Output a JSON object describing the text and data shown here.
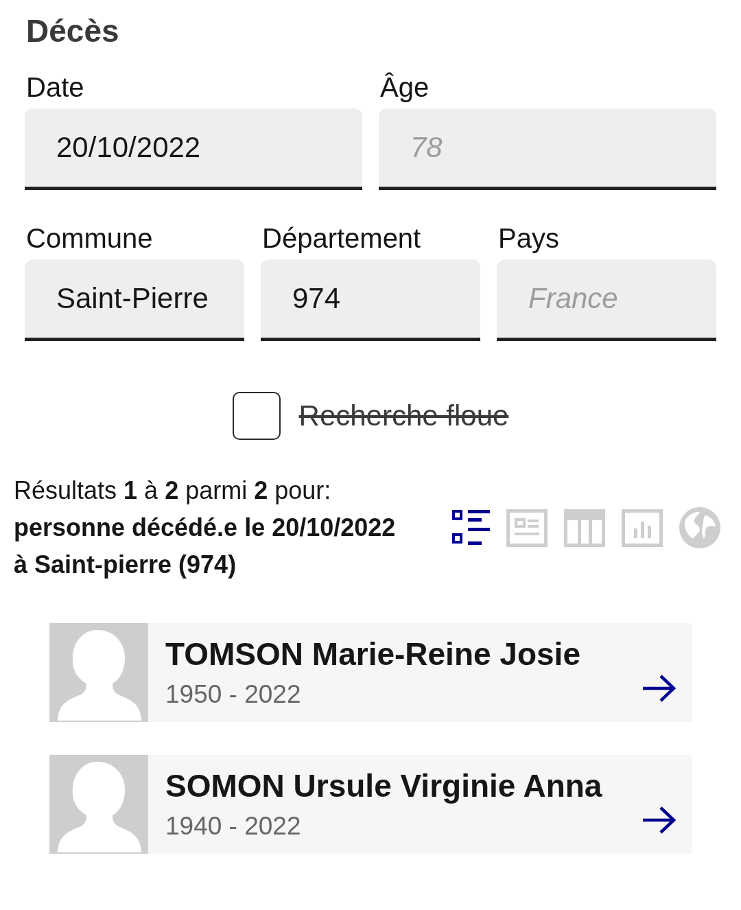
{
  "section": {
    "title": "Décès"
  },
  "field_rows": [
    [
      {
        "label": "Date",
        "value": "20/10/2022"
      },
      {
        "label": "Âge",
        "placeholder": "78"
      }
    ],
    [
      {
        "label": "Commune",
        "value": "Saint-Pierre"
      },
      {
        "label": "Département",
        "value": "974"
      },
      {
        "label": "Pays",
        "placeholder": "France"
      }
    ]
  ],
  "fuzzy_search": {
    "label": "Recherche floue",
    "checked": false,
    "struck": true
  },
  "results_summary": {
    "text": "Résultats **1** à **2** parmi **2** pour:",
    "query": "personne décédé.e le 20/10/2022 à Saint-pierre (974)"
  },
  "views": [
    {
      "kind": "list",
      "selected": true
    },
    {
      "kind": "cards",
      "selected": false
    },
    {
      "kind": "table",
      "selected": false
    },
    {
      "kind": "chart",
      "selected": false
    },
    {
      "kind": "map",
      "selected": false
    }
  ],
  "results": [
    {
      "name": "TOMSON Marie-Reine Josie",
      "years": "1950 - 2022"
    },
    {
      "name": "SOMON Ursule Virginie Anna",
      "years": "1940 - 2022"
    }
  ]
}
